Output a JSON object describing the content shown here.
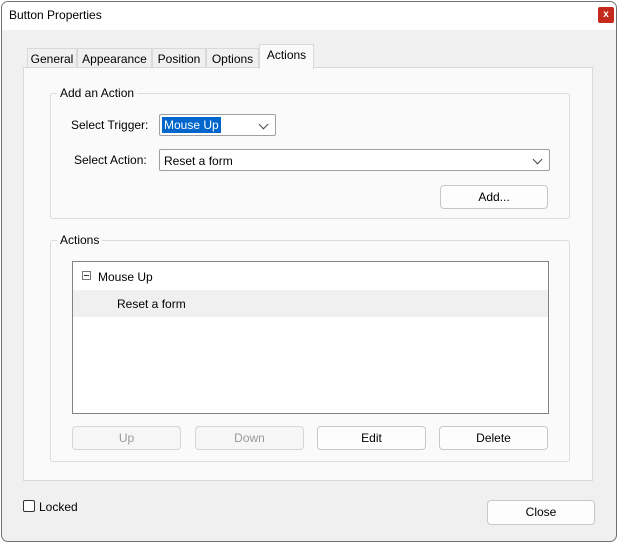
{
  "window": {
    "title": "Button Properties",
    "close_glyph": "x"
  },
  "tabs": [
    {
      "label": "General"
    },
    {
      "label": "Appearance"
    },
    {
      "label": "Position"
    },
    {
      "label": "Options"
    },
    {
      "label": "Actions",
      "active": true
    }
  ],
  "add_action": {
    "legend": "Add an Action",
    "trigger_label": "Select Trigger:",
    "trigger_value": "Mouse Up",
    "action_label": "Select Action:",
    "action_value": "Reset a form",
    "add_button": "Add..."
  },
  "actions": {
    "legend": "Actions",
    "tree": [
      {
        "label": "Mouse Up",
        "icon": "collapse-minus-icon"
      },
      {
        "label": "Reset a form"
      }
    ],
    "buttons": {
      "up": "Up",
      "down": "Down",
      "edit": "Edit",
      "delete": "Delete"
    }
  },
  "footer": {
    "locked_label": "Locked",
    "locked_checked": false,
    "close_button": "Close"
  },
  "colors": {
    "accent": "#0066cc",
    "close_red": "#c42b1c"
  }
}
